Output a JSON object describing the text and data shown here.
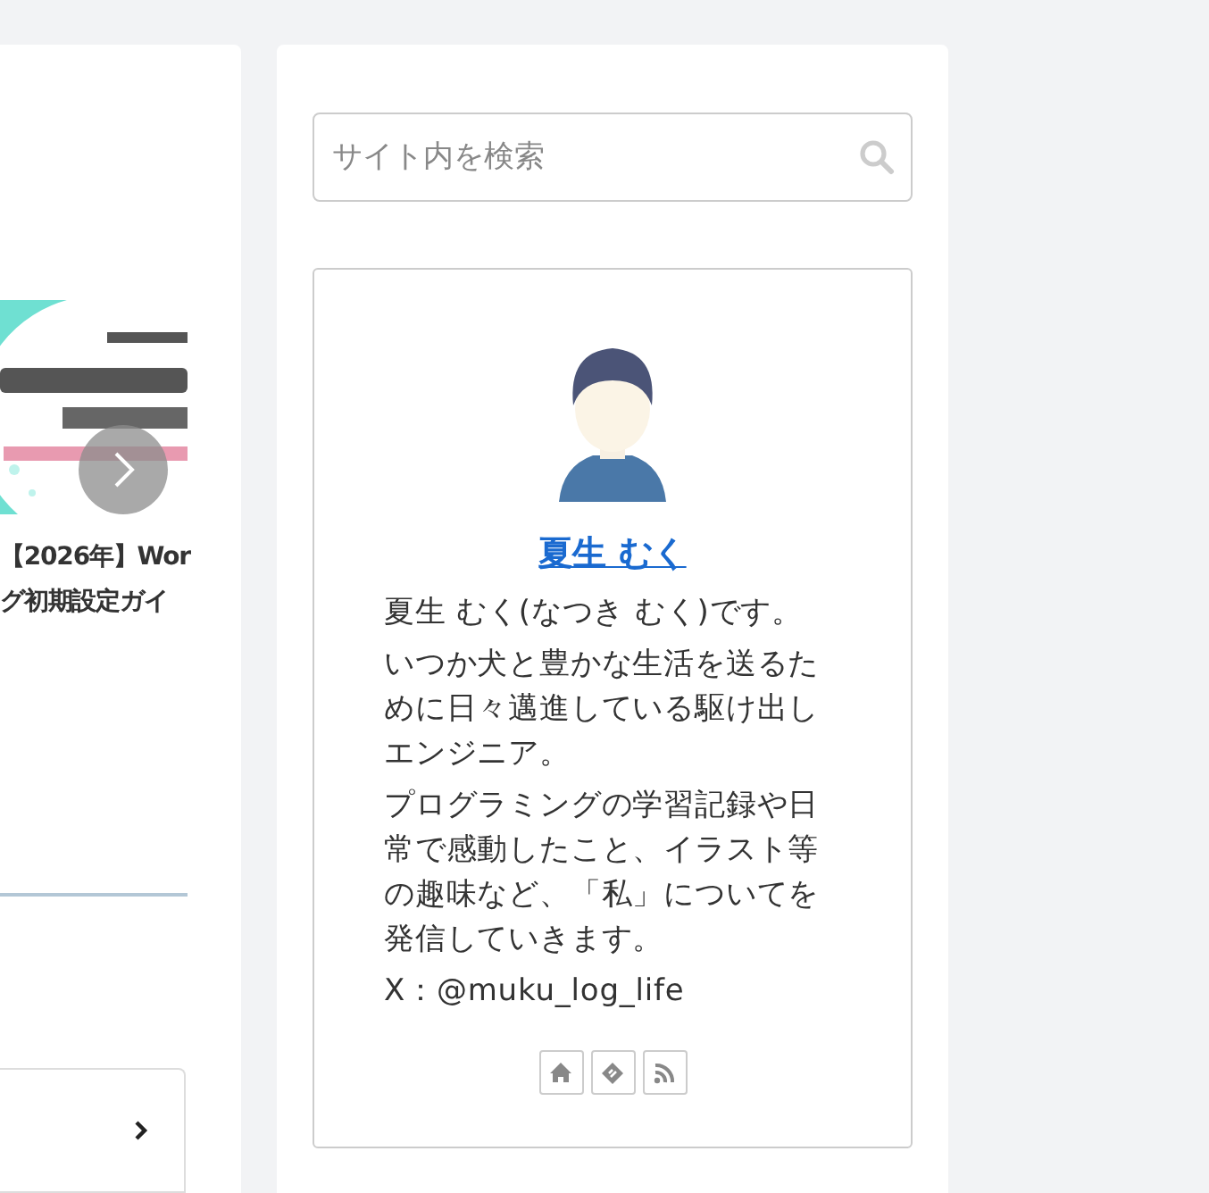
{
  "main": {
    "card": {
      "thumbnail": {
        "kind": "picture"
      },
      "caption": [
        "【2026年】Wor",
        "グ初期設定ガイ"
      ]
    }
  },
  "sidebar": {
    "search": {
      "placeholder": "サイト内を検索"
    },
    "profile": {
      "name": "夏生 むく",
      "paragraphs": [
        "夏生 むく(なつき むく)です。",
        "いつか犬と豊かな生活を送るために日々邁進している駆け出しエンジニア。",
        "プログラミングの学習記録や日常で感動したこと、イラスト等の趣味など、「私」についてを発信していきます。",
        "X：@muku_log_life"
      ],
      "links": [
        {
          "kind": "home"
        },
        {
          "kind": "feedly"
        },
        {
          "kind": "rss"
        }
      ]
    }
  }
}
